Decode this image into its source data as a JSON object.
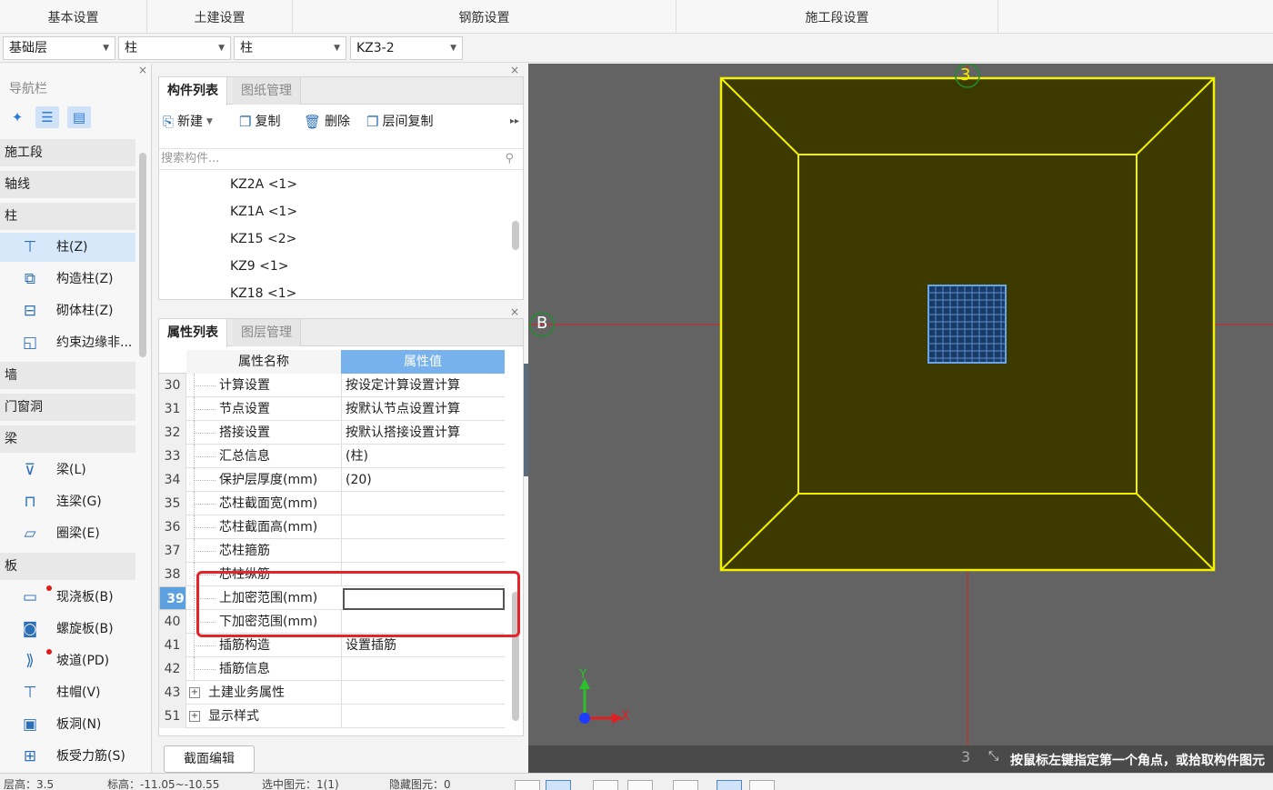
{
  "ribbon": {
    "tabs": [
      "基本设置",
      "土建设置",
      "钢筋设置",
      "施工段设置"
    ]
  },
  "selectors": [
    {
      "value": "基础层"
    },
    {
      "value": "柱"
    },
    {
      "value": "柱"
    },
    {
      "value": "KZ3-2"
    }
  ],
  "nav": {
    "title": "导航栏",
    "close": "×",
    "categories": [
      {
        "label": "施工段"
      },
      {
        "label": "轴线"
      },
      {
        "label": "柱"
      },
      {
        "label": "墙"
      },
      {
        "label": "门窗洞"
      },
      {
        "label": "梁"
      },
      {
        "label": "板"
      }
    ],
    "items": [
      {
        "label": "柱(Z)",
        "icon": "column-icon"
      },
      {
        "label": "构造柱(Z)",
        "icon": "construction-column-icon"
      },
      {
        "label": "砌体柱(Z)",
        "icon": "masonry-column-icon"
      },
      {
        "label": "约束边缘非...",
        "icon": "edge-member-icon"
      },
      {
        "label": "梁(L)",
        "icon": "beam-icon"
      },
      {
        "label": "连梁(G)",
        "icon": "link-beam-icon"
      },
      {
        "label": "圈梁(E)",
        "icon": "ring-beam-icon"
      },
      {
        "label": "现浇板(B)",
        "icon": "cast-slab-icon"
      },
      {
        "label": "螺旋板(B)",
        "icon": "spiral-slab-icon"
      },
      {
        "label": "坡道(PD)",
        "icon": "ramp-icon"
      },
      {
        "label": "柱帽(V)",
        "icon": "column-cap-icon"
      },
      {
        "label": "板洞(N)",
        "icon": "slab-hole-icon"
      },
      {
        "label": "板受力筋(S)",
        "icon": "slab-rebar-icon"
      }
    ]
  },
  "components": {
    "tabs": [
      "构件列表",
      "图纸管理"
    ],
    "toolbar": {
      "new": "新建",
      "copy": "复制",
      "delete": "删除",
      "floor_copy": "层间复制",
      "more": "▸▸"
    },
    "search_placeholder": "搜索构件...",
    "list": [
      "KZ2A <1>",
      "KZ1A <1>",
      "KZ15 <2>",
      "KZ9 <1>",
      "KZ18 <1>"
    ]
  },
  "properties": {
    "tabs": [
      "属性列表",
      "图层管理"
    ],
    "col_name": "属性名称",
    "col_value": "属性值",
    "rows": [
      {
        "num": "30",
        "name": "计算设置",
        "value": "按设定计算设置计算"
      },
      {
        "num": "31",
        "name": "节点设置",
        "value": "按默认节点设置计算"
      },
      {
        "num": "32",
        "name": "搭接设置",
        "value": "按默认搭接设置计算"
      },
      {
        "num": "33",
        "name": "汇总信息",
        "value": "(柱)"
      },
      {
        "num": "34",
        "name": "保护层厚度(mm)",
        "value": "(20)"
      },
      {
        "num": "35",
        "name": "芯柱截面宽(mm)",
        "value": ""
      },
      {
        "num": "36",
        "name": "芯柱截面高(mm)",
        "value": ""
      },
      {
        "num": "37",
        "name": "芯柱箍筋",
        "value": ""
      },
      {
        "num": "38",
        "name": "芯柱纵筋",
        "value": ""
      },
      {
        "num": "39",
        "name": "上加密范围(mm)",
        "value": ""
      },
      {
        "num": "40",
        "name": "下加密范围(mm)",
        "value": ""
      },
      {
        "num": "41",
        "name": "插筋构造",
        "value": "设置插筋"
      },
      {
        "num": "42",
        "name": "插筋信息",
        "value": ""
      },
      {
        "num": "43",
        "name": "土建业务属性",
        "value": ""
      },
      {
        "num": "51",
        "name": "显示样式",
        "value": ""
      }
    ],
    "button": "截面编辑"
  },
  "canvas": {
    "axis_top": "3",
    "axis_left": "B",
    "axis_bottom": "3",
    "y_label": "Y",
    "x_label": "X",
    "status": "按鼠标左键指定第一个角点，或拾取构件图元"
  },
  "bottom": {
    "floor_height": "层高：3.5",
    "elevation": "标高：-11.05~-10.55",
    "selected": "选中图元：1(1)",
    "hidden": "隐藏图元：0"
  },
  "colors": {
    "footing_fill": "#3d3a00",
    "footing_stroke": "#f2f200",
    "column_stroke": "#6aa6ec",
    "axis_red": "#d72020",
    "axis_green": "#1e8c2e",
    "highlight_red": "#e5242a"
  }
}
